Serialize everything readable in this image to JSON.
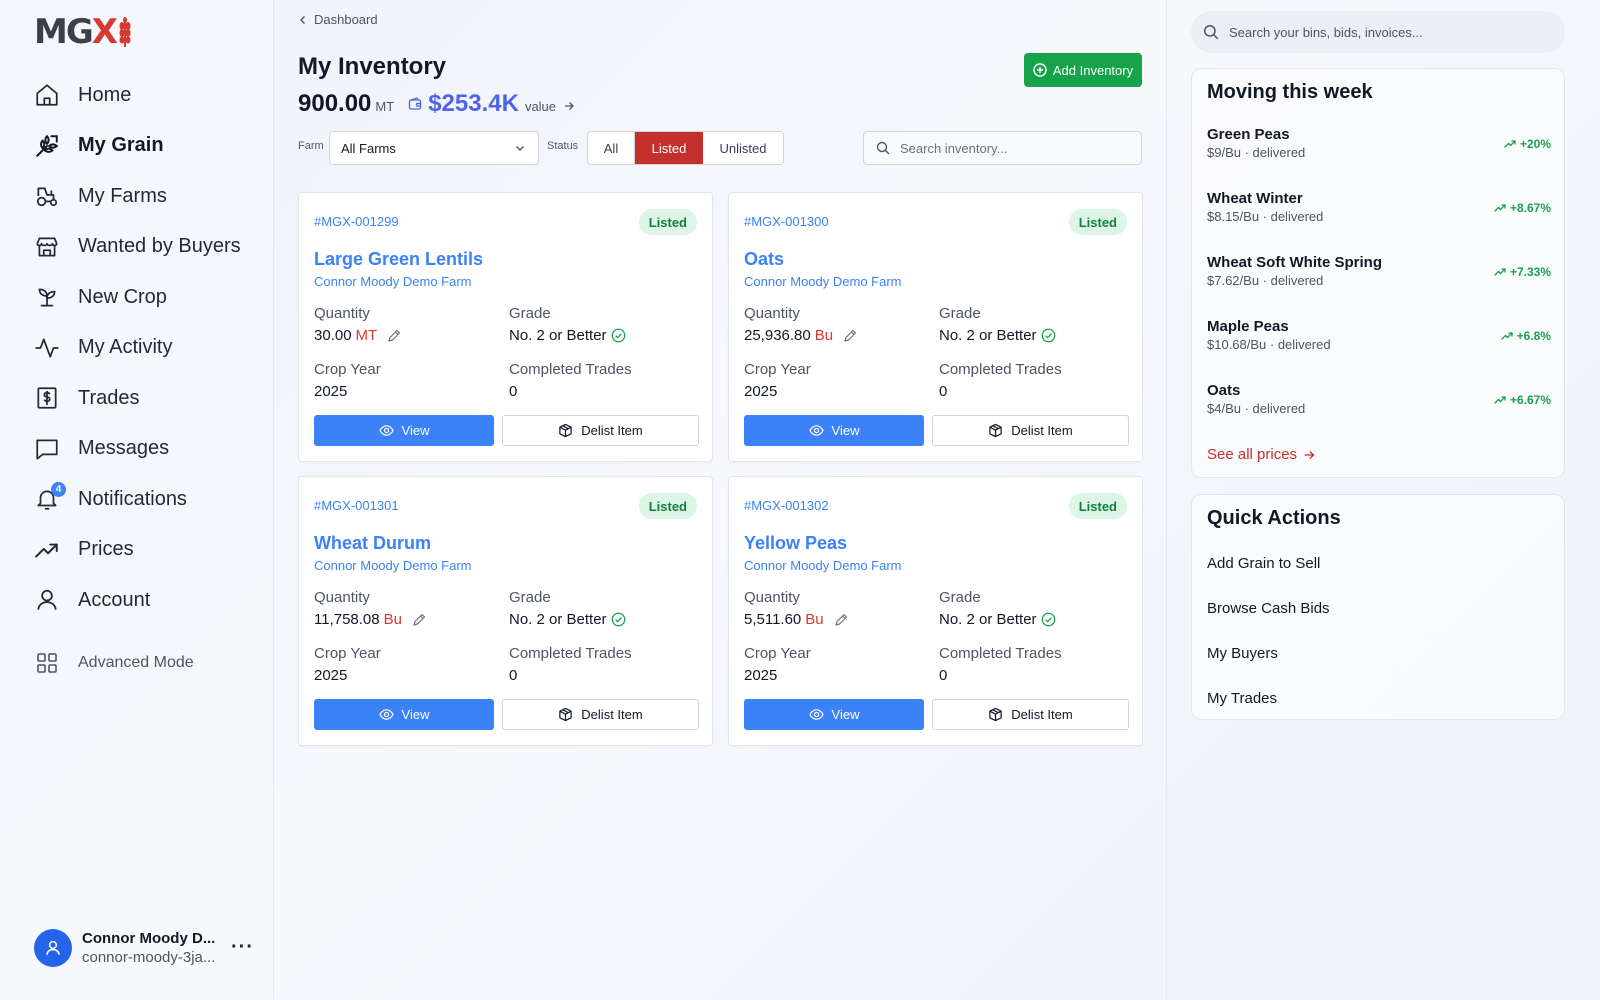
{
  "brand": {
    "logo_main": "MG",
    "logo_x": "X"
  },
  "sidebar": {
    "items": [
      {
        "label": "Home",
        "icon": "home-icon"
      },
      {
        "label": "My Grain",
        "icon": "grain-icon",
        "active": true
      },
      {
        "label": "My Farms",
        "icon": "tractor-icon"
      },
      {
        "label": "Wanted by Buyers",
        "icon": "store-icon"
      },
      {
        "label": "New Crop",
        "icon": "sprout-icon"
      },
      {
        "label": "My Activity",
        "icon": "activity-icon"
      },
      {
        "label": "Trades",
        "icon": "dollar-receipt-icon"
      },
      {
        "label": "Messages",
        "icon": "message-icon"
      },
      {
        "label": "Notifications",
        "icon": "bell-icon",
        "badge": "4"
      },
      {
        "label": "Prices",
        "icon": "trending-up-icon"
      },
      {
        "label": "Account",
        "icon": "user-icon"
      }
    ],
    "advanced_mode": "Advanced Mode",
    "user": {
      "name": "Connor Moody D...",
      "handle": "connor-moody-3ja...",
      "more": "···"
    }
  },
  "header": {
    "breadcrumb": "Dashboard",
    "title": "My Inventory",
    "add_button": "Add Inventory",
    "summary": {
      "amount": "900.00",
      "unit": "MT",
      "value": "$253.4K",
      "value_label": "value"
    }
  },
  "filters": {
    "farm_label": "Farm",
    "farm_value": "All Farms",
    "status_label": "Status",
    "status_options": [
      "All",
      "Listed",
      "Unlisted"
    ],
    "status_selected": "Listed",
    "search_placeholder": "Search inventory..."
  },
  "labels": {
    "quantity": "Quantity",
    "grade": "Grade",
    "crop_year": "Crop Year",
    "completed_trades": "Completed Trades",
    "view": "View",
    "delist": "Delist Item"
  },
  "cards": [
    {
      "id": "#MGX-001299",
      "status": "Listed",
      "name": "Large Green Lentils",
      "farm": "Connor Moody Demo Farm",
      "quantity": "30.00",
      "unit": "MT",
      "grade": "No. 2 or Better",
      "crop_year": "2025",
      "completed_trades": "0"
    },
    {
      "id": "#MGX-001300",
      "status": "Listed",
      "name": "Oats",
      "farm": "Connor Moody Demo Farm",
      "quantity": "25,936.80",
      "unit": "Bu",
      "grade": "No. 2 or Better",
      "crop_year": "2025",
      "completed_trades": "0"
    },
    {
      "id": "#MGX-001301",
      "status": "Listed",
      "name": "Wheat Durum",
      "farm": "Connor Moody Demo Farm",
      "quantity": "11,758.08",
      "unit": "Bu",
      "grade": "No. 2 or Better",
      "crop_year": "2025",
      "completed_trades": "0"
    },
    {
      "id": "#MGX-001302",
      "status": "Listed",
      "name": "Yellow Peas",
      "farm": "Connor Moody Demo Farm",
      "quantity": "5,511.60",
      "unit": "Bu",
      "grade": "No. 2 or Better",
      "crop_year": "2025",
      "completed_trades": "0"
    }
  ],
  "right_panel": {
    "search_placeholder": "Search your bins, bids, invoices...",
    "moving": {
      "title": "Moving this week",
      "items": [
        {
          "name": "Green Peas",
          "sub": "$9/Bu · delivered",
          "change": "+20%"
        },
        {
          "name": "Wheat Winter",
          "sub": "$8.15/Bu · delivered",
          "change": "+8.67%"
        },
        {
          "name": "Wheat Soft White Spring",
          "sub": "$7.62/Bu · delivered",
          "change": "+7.33%"
        },
        {
          "name": "Maple Peas",
          "sub": "$10.68/Bu · delivered",
          "change": "+6.8%"
        },
        {
          "name": "Oats",
          "sub": "$4/Bu · delivered",
          "change": "+6.67%"
        }
      ],
      "see_all": "See all prices"
    },
    "quick_actions": {
      "title": "Quick Actions",
      "items": [
        "Add Grain to Sell",
        "Browse Cash Bids",
        "My Buyers",
        "My Trades"
      ]
    }
  },
  "colors": {
    "primary_blue": "#3b82f6",
    "brand_red": "#c4302b",
    "success_green": "#16a34a",
    "value_purple": "#4f63e9"
  }
}
